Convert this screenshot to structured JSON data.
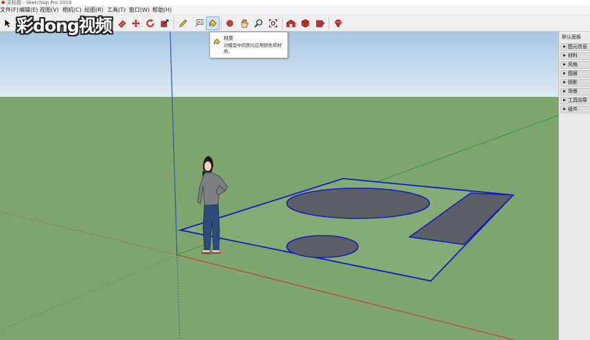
{
  "window": {
    "title": "无标题 - SketchUp Pro 2018"
  },
  "menu": {
    "items": [
      "文件(F)",
      "编辑(E)",
      "视图(V)",
      "相机(C)",
      "绘图(R)",
      "工具(T)",
      "窗口(W)",
      "帮助(H)"
    ]
  },
  "toolbar": {
    "icons": [
      "select-icon",
      "eraser-icon",
      "move-icon",
      "rotate-icon",
      "scale-icon",
      "pencil-icon",
      "text-icon",
      "paint-bucket-icon",
      "orbit-icon",
      "pan-icon",
      "zoom-icon",
      "zoom-extents-icon",
      "warehouse-icon",
      "extension-icon",
      "share-icon",
      "ruby-icon"
    ],
    "active": "paint-bucket-icon"
  },
  "watermark": {
    "text": "彩dong视频"
  },
  "tooltip": {
    "title": "材质",
    "description": "对模型中的图元应用颜色和材质。"
  },
  "tray": {
    "title": "默认面板",
    "panels": [
      "图元信息",
      "材料",
      "风格",
      "图层",
      "阴影",
      "场景",
      "工具向导",
      "组件"
    ]
  },
  "colors": {
    "sky": "#a9c9e4",
    "ground": "#7fa46c",
    "shape_fill": "#5a5f66",
    "selection": "#1616c8",
    "axis_red": "#c0392b",
    "axis_green": "#2e9a38",
    "axis_blue": "#2e4fb8"
  }
}
